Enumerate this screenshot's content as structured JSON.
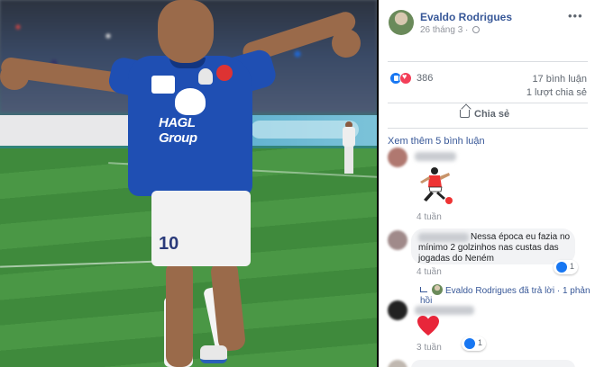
{
  "photo": {
    "description_alt": "",
    "jersey_sponsor": "HAGL Group",
    "shorts_number": "10"
  },
  "post": {
    "author": "Evaldo Rodrigues",
    "date": "26 tháng 3",
    "more_icon": "ellipsis-icon",
    "reaction_count": "386",
    "reactions": [
      "like-icon",
      "love-icon"
    ],
    "comment_count": "17 bình luận",
    "share_count": "1 lượt chia sẻ",
    "share_label": "Chia sẻ"
  },
  "comments": {
    "see_more": "Xem thêm 5 bình luận",
    "items": [
      {
        "sticker": "footballer-sticker",
        "time": "4 tuần"
      },
      {
        "text": "Nessa época eu fazia no mínimo 2 golzinhos nas custas das jogadas do Neném",
        "time": "4 tuần",
        "reaction_count": "1"
      },
      {
        "reply_summary": "Evaldo Rodrigues đã trả lời · 1 phản hồi"
      },
      {
        "emoji": "heart",
        "time": "3 tuần",
        "reaction_count": "1"
      }
    ]
  },
  "colors": {
    "link": "#385898",
    "like": "#1877f2",
    "love": "#f33e58",
    "jersey": "#1f4fb3"
  }
}
